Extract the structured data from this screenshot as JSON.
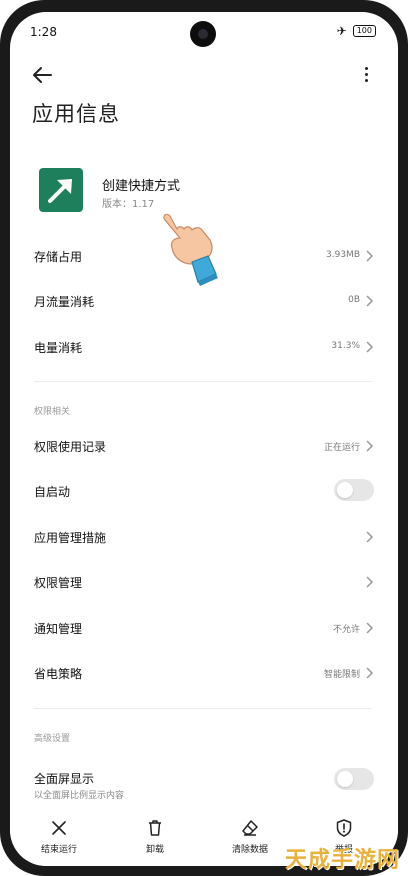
{
  "status_bar": {
    "time": "1:28",
    "battery": "100"
  },
  "page": {
    "title": "应用信息"
  },
  "app": {
    "name": "创建快捷方式",
    "version": "版本：1.17"
  },
  "rows_top": [
    {
      "label": "存储占用",
      "value": "3.93MB"
    },
    {
      "label": "月流量消耗",
      "value": "0B"
    },
    {
      "label": "电量消耗",
      "value": "31.3%"
    }
  ],
  "section_permissions": "权限相关",
  "rows_permissions": [
    {
      "label": "权限使用记录",
      "value": "正在运行"
    },
    {
      "label": "自启动",
      "toggle": false
    },
    {
      "label": "应用管理措施"
    },
    {
      "label": "权限管理"
    },
    {
      "label": "通知管理",
      "value": "不允许"
    },
    {
      "label": "省电策略",
      "value": "智能限制"
    }
  ],
  "section_advanced": "高级设置",
  "fullscreen": {
    "label": "全面屏显示",
    "sub": "以全面屏比例显示内容",
    "toggle": false
  },
  "bottom_bar": [
    {
      "label": "结束运行",
      "icon": "close-icon"
    },
    {
      "label": "卸载",
      "icon": "trash-icon"
    },
    {
      "label": "清除数据",
      "icon": "eraser-icon"
    },
    {
      "label": "举报",
      "icon": "shield-alert-icon"
    }
  ],
  "watermark": "天成手游网",
  "colors": {
    "app_icon_bg": "#1e7f5c",
    "toggle_off": "#e6e6e6"
  }
}
